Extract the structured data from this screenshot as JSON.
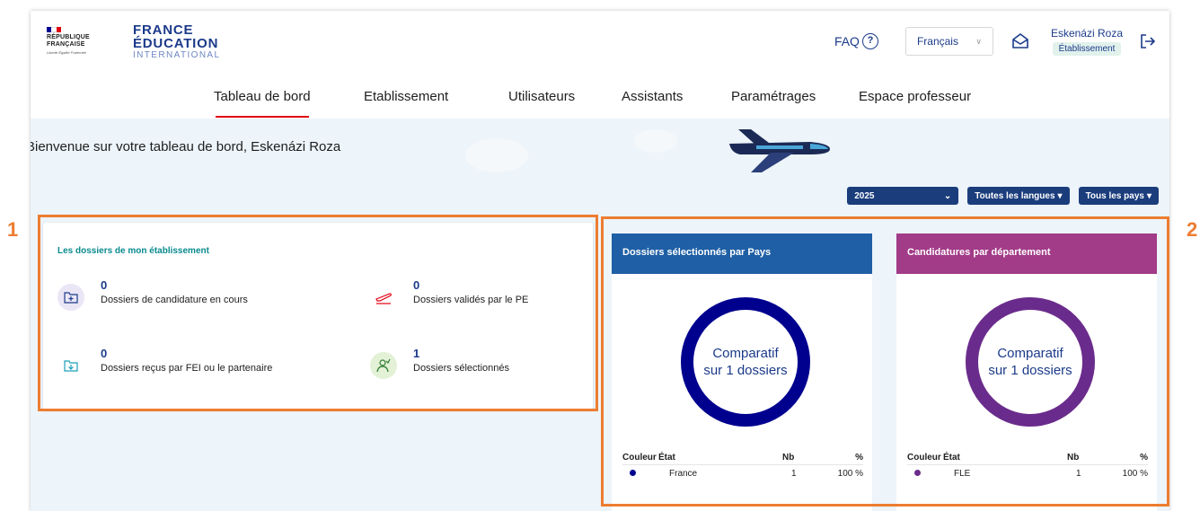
{
  "logos": {
    "republic_line1": "RÉPUBLIQUE",
    "republic_line2": "FRANÇAISE",
    "devise": "Liberté Égalité Fraternité",
    "brand_line1": "FRANCE",
    "brand_line2": "ÉDUCATION",
    "brand_line3": "INTERNATIONAL"
  },
  "header": {
    "faq_label": "FAQ",
    "faq_icon_text": "?",
    "language_selected": "Français",
    "user_name": "Eskenázi Roza",
    "user_role": "Établissement"
  },
  "nav": {
    "items": [
      {
        "label": "Tableau de bord",
        "active": true
      },
      {
        "label": "Etablissement"
      },
      {
        "label": "Utilisateurs"
      },
      {
        "label": "Assistants"
      },
      {
        "label": "Paramétrages"
      },
      {
        "label": "Espace professeur"
      }
    ]
  },
  "dashboard": {
    "welcome": "Bienvenue sur votre tableau de bord, Eskenázi Roza",
    "filters": {
      "year": "2025",
      "languages": "Toutes les langues",
      "countries": "Tous les pays"
    }
  },
  "dossiers_card": {
    "title": "Les dossiers de mon établissement",
    "stats": [
      {
        "value": "0",
        "label": "Dossiers de candidature en cours",
        "icon": "folder-plus-icon"
      },
      {
        "value": "0",
        "label": "Dossiers validés par le PE",
        "icon": "plane-takeoff-icon"
      },
      {
        "value": "0",
        "label": "Dossiers reçus par FEI ou le partenaire",
        "icon": "folder-download-icon"
      },
      {
        "value": "1",
        "label": "Dossiers sélectionnés",
        "icon": "user-check-icon"
      }
    ]
  },
  "chart_pays": {
    "title": "Dossiers sélectionnés par Pays",
    "center_line1": "Comparatif",
    "center_line2": "sur 1 dossiers",
    "color": "#00008f",
    "table_headers": {
      "couleur": "Couleur",
      "etat": "État",
      "nb": "Nb",
      "pct": "%"
    },
    "rows": [
      {
        "etat": "France",
        "nb": "1",
        "pct": "100 %"
      }
    ]
  },
  "chart_departement": {
    "title": "Candidatures par département",
    "center_line1": "Comparatif",
    "center_line2": "sur 1 dossiers",
    "color": "#6a2c8c",
    "table_headers": {
      "couleur": "Couleur",
      "etat": "État",
      "nb": "Nb",
      "pct": "%"
    },
    "rows": [
      {
        "etat": "FLE",
        "nb": "1",
        "pct": "100 %"
      }
    ]
  },
  "annotations": {
    "label1": "1",
    "label2": "2"
  },
  "colors": {
    "brand_blue": "#1b3a8a",
    "pays_header": "#1f5fa5",
    "departement_header": "#a23b88",
    "callout": "#ed7d31",
    "active_tab": "#e1000f"
  }
}
